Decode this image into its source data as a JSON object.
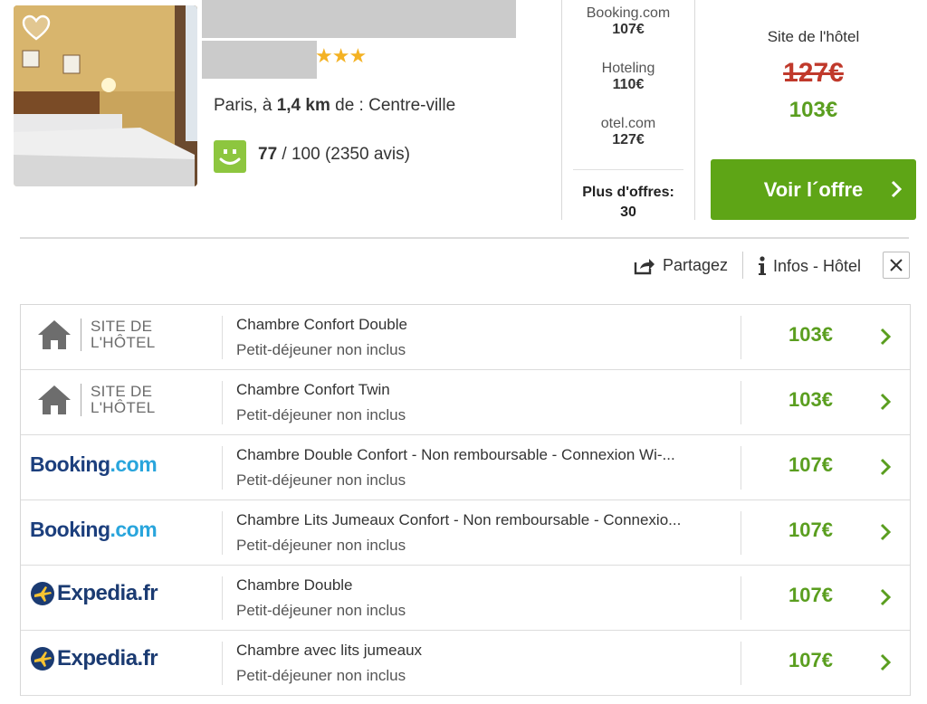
{
  "hotel": {
    "stars": "★★★",
    "location_prefix": "Paris, à",
    "distance": "1,4 km",
    "location_suffix": "de : Centre-ville",
    "rating_score": "77",
    "rating_rest": "/ 100 (2350 avis)",
    "favorite_icon": "heart-icon",
    "rating_icon": "smiley-icon"
  },
  "price_compare": [
    {
      "provider": "Booking.com",
      "price": "107€"
    },
    {
      "provider": "Hoteling",
      "price": "110€"
    },
    {
      "provider": "otel.com",
      "price": "127€"
    }
  ],
  "more_offers": {
    "label": "Plus d'offres:",
    "count": "30"
  },
  "best_offer": {
    "site_label": "Site de l'hôtel",
    "old_price": "127€",
    "new_price": "103€",
    "cta_label": "Voir l´offre"
  },
  "actions": {
    "share_label": "Partagez",
    "info_label": "Infos - Hôtel"
  },
  "offers": [
    {
      "provider": "site",
      "logo_line1": "SITE DE",
      "logo_line2": "L'HÔTEL",
      "title": "Chambre Confort Double",
      "subtitle": "Petit-déjeuner non inclus",
      "price": "103€"
    },
    {
      "provider": "site",
      "logo_line1": "SITE DE",
      "logo_line2": "L'HÔTEL",
      "title": "Chambre Confort Twin",
      "subtitle": "Petit-déjeuner non inclus",
      "price": "103€"
    },
    {
      "provider": "booking",
      "logo_text_a": "Booking",
      "logo_text_b": ".com",
      "title": "Chambre Double Confort - Non remboursable - Connexion Wi-...",
      "subtitle": "Petit-déjeuner non inclus",
      "price": "107€"
    },
    {
      "provider": "booking",
      "logo_text_a": "Booking",
      "logo_text_b": ".com",
      "title": "Chambre Lits Jumeaux Confort - Non remboursable - Connexio...",
      "subtitle": "Petit-déjeuner non inclus",
      "price": "107€"
    },
    {
      "provider": "expedia",
      "logo_text": "Expedia.fr",
      "title": "Chambre Double",
      "subtitle": "Petit-déjeuner non inclus",
      "price": "107€"
    },
    {
      "provider": "expedia",
      "logo_text": "Expedia.fr",
      "title": "Chambre avec lits jumeaux",
      "subtitle": "Petit-déjeuner non inclus",
      "price": "107€"
    }
  ],
  "colors": {
    "accent_green": "#5ea516",
    "price_green": "#5a9e1f",
    "strike_red": "#c0392b",
    "star_gold": "#f4b223"
  }
}
